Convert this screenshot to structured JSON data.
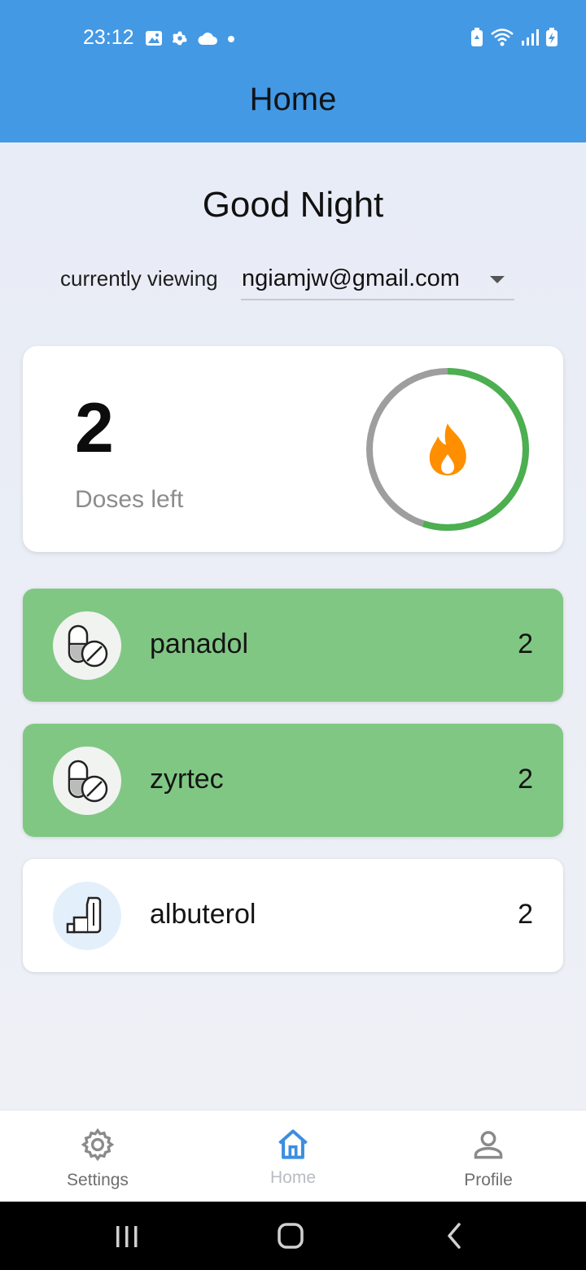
{
  "status_bar": {
    "time": "23:12",
    "icons_left": [
      "image-icon",
      "gear-icon",
      "cloud-icon",
      "dot-icon"
    ],
    "icons_right": [
      "battery-saver-icon",
      "wifi-icon",
      "signal-icon",
      "battery-charging-icon"
    ]
  },
  "app_bar": {
    "title": "Home"
  },
  "greeting": "Good Night",
  "viewing": {
    "label": "currently viewing",
    "account": "ngiamjw@gmail.com"
  },
  "dose_summary": {
    "count": "2",
    "label": "Doses left",
    "progress_fraction": 0.55,
    "icon": "fire-icon",
    "colors": {
      "progress": "#4caf50",
      "track": "#9e9e9e",
      "fire": "#ff8f00"
    }
  },
  "medications": [
    {
      "name": "panadol",
      "count": "2",
      "icon": "pills-icon",
      "taken": true
    },
    {
      "name": "zyrtec",
      "count": "2",
      "icon": "pills-icon",
      "taken": true
    },
    {
      "name": "albuterol",
      "count": "2",
      "icon": "inhaler-icon",
      "taken": false
    }
  ],
  "colors": {
    "app_bar": "#4499e4",
    "taken_row": "#81c784",
    "pending_row": "#ffffff",
    "active_nav": "#3c8ee0",
    "inactive_nav": "#8a8a8a"
  },
  "bottom_nav": [
    {
      "label": "Settings",
      "icon": "gear-icon",
      "active": false
    },
    {
      "label": "Home",
      "icon": "home-icon",
      "active": true
    },
    {
      "label": "Profile",
      "icon": "person-icon",
      "active": false
    }
  ],
  "system_nav": [
    "recents-button",
    "home-button",
    "back-button"
  ]
}
